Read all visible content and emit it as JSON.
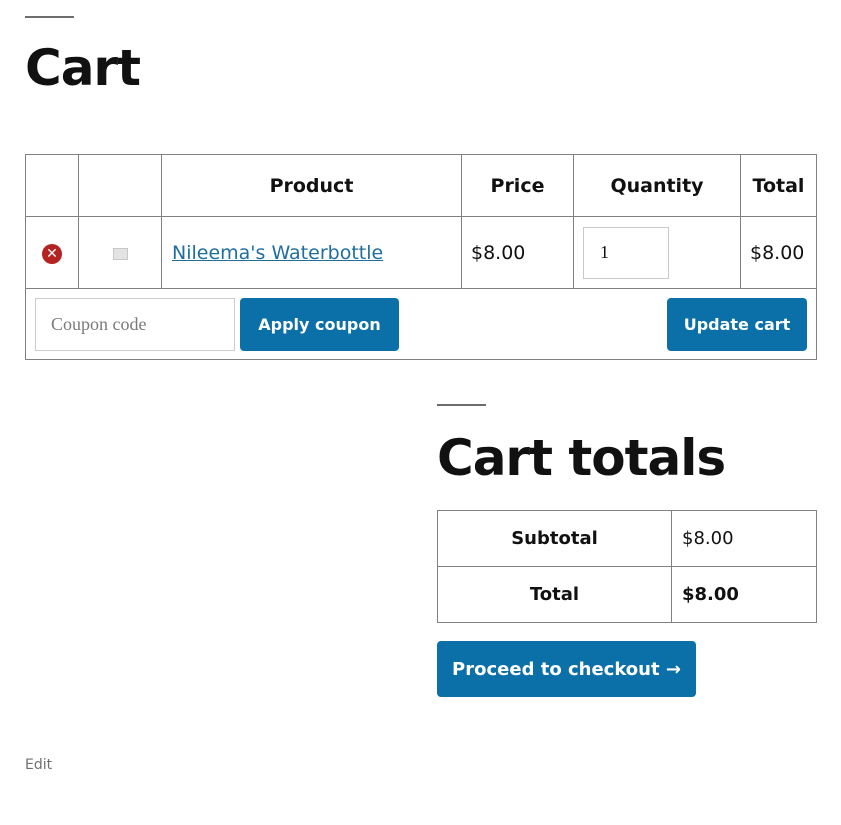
{
  "page": {
    "title": "Cart"
  },
  "cart_table": {
    "headers": {
      "product": "Product",
      "price": "Price",
      "quantity": "Quantity",
      "total": "Total"
    },
    "items": [
      {
        "remove_icon": "remove-circle-icon",
        "thumbnail_icon": "image-placeholder-icon",
        "product": "Nileema's Waterbottle",
        "price": "$8.00",
        "quantity": "1",
        "total": "$8.00"
      }
    ],
    "coupon": {
      "placeholder": "Coupon code",
      "value": ""
    },
    "apply_label": "Apply coupon",
    "update_label": "Update cart"
  },
  "totals": {
    "title": "Cart totals",
    "rows": [
      {
        "label": "Subtotal",
        "value": "$8.00"
      },
      {
        "label": "Total",
        "value": "$8.00"
      }
    ],
    "checkout_label": "Proceed to checkout →"
  },
  "footer": {
    "edit_label": "Edit"
  },
  "colors": {
    "accent": "#0b6fa8",
    "remove": "#b42222",
    "link": "#1f6e9e"
  }
}
